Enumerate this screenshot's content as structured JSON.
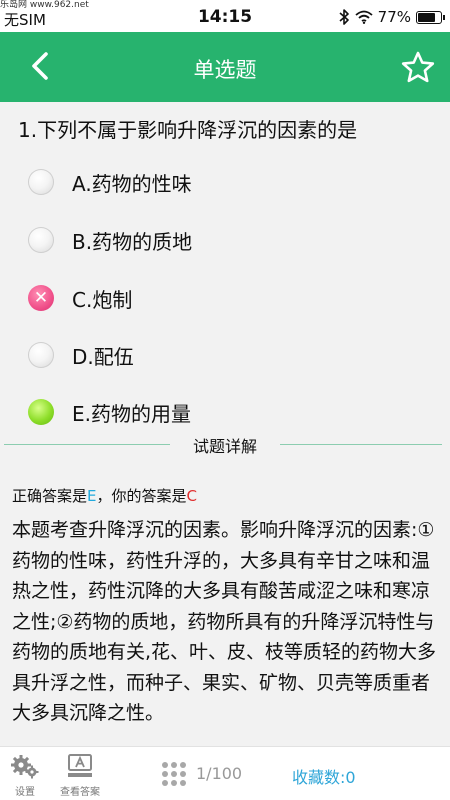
{
  "status_bar": {
    "watermark": "乐岛网 www.962.net",
    "carrier": "无SIM",
    "time": "14:15",
    "battery_percent": "77%",
    "battery_level": 0.77,
    "icons": [
      "bluetooth-icon",
      "wifi-icon",
      "battery-icon"
    ]
  },
  "header": {
    "title": "单选题",
    "back_icon": "chevron-left-icon",
    "favorite_icon": "star-outline-icon",
    "background_color": "#27b36e"
  },
  "question": {
    "text": "1.下列不属于影响升降浮沉的因素的是",
    "options": [
      {
        "label": "A.药物的性味",
        "state": "unselected"
      },
      {
        "label": "B.药物的质地",
        "state": "unselected"
      },
      {
        "label": "C.炮制",
        "state": "wrong"
      },
      {
        "label": "D.配伍",
        "state": "unselected"
      },
      {
        "label": "E.药物的用量",
        "state": "correct"
      }
    ]
  },
  "explanation": {
    "section_title": "试题详解",
    "correct_prefix": "正确答案是",
    "correct_answer": "E",
    "separator": "，",
    "your_prefix": "你的答案是",
    "your_answer": "C",
    "analysis_text": "本题考查升降浮沉的因素。影响升降浮沉的因素:①药物的性味，药性升浮的，大多具有辛甘之味和温热之性，药性沉降的大多具有酸苦咸涩之味和寒凉之性;②药物的质地，药物所具有的升降浮沉特性与药物的质地有关,花、叶、皮、枝等质轻的药物大多具升浮之性，而种子、果实、矿物、贝壳等质重者大多具沉降之性。"
  },
  "bottom_bar": {
    "settings_label": "设置",
    "view_answer_label": "查看答案",
    "progress": "1/100",
    "favorites": "收藏数:0",
    "colors": {
      "progress": "#999999",
      "favorites": "#2fa6d8"
    }
  }
}
